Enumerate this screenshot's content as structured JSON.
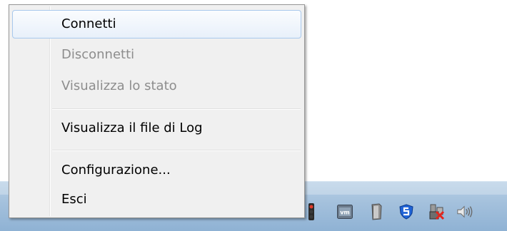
{
  "menu": {
    "items": [
      {
        "label": "Connetti",
        "state": "highlighted"
      },
      {
        "label": "Disconnetti",
        "state": "disabled"
      },
      {
        "label": "Visualizza lo stato",
        "state": "disabled"
      },
      {
        "label": "Visualizza il file di Log",
        "state": "enabled"
      },
      {
        "label": "Configurazione...",
        "state": "enabled"
      },
      {
        "label": "Esci",
        "state": "enabled"
      }
    ]
  },
  "tray": {
    "icons": [
      {
        "name": "traffic-light-icon"
      },
      {
        "name": "vmware-icon"
      },
      {
        "name": "file-icon"
      },
      {
        "name": "shield-s-icon"
      },
      {
        "name": "network-disconnected-icon"
      },
      {
        "name": "speaker-icon"
      }
    ],
    "vmware_label": "vm"
  },
  "colors": {
    "menu_background": "#f0f0f0",
    "menu_border": "#979797",
    "highlight_border": "#a8c8ec",
    "disabled_text": "#8d8d8d",
    "taskbar": "#a3c0dc"
  }
}
